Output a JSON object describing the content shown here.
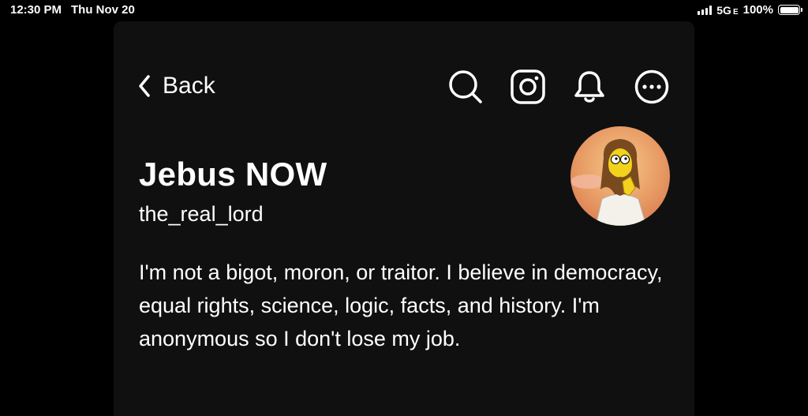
{
  "status_bar": {
    "time": "12:30 PM",
    "date": "Thu Nov 20",
    "network": "5G",
    "network_suffix": "E",
    "battery": "100%",
    "battery_level": 1.0
  },
  "header": {
    "back_label": "Back",
    "icons": [
      "search-icon",
      "instagram-icon",
      "bell-icon",
      "more-icon"
    ]
  },
  "profile": {
    "display_name": "Jebus NOW",
    "username": "the_real_lord",
    "bio": "I'm not a bigot, moron, or traitor. I believe in democracy, equal rights, science, logic, facts, and history. I'm anonymous so I don't lose my job."
  },
  "colors": {
    "page_background": "#000000",
    "sheet_background": "#101010",
    "text": "#ffffff"
  }
}
